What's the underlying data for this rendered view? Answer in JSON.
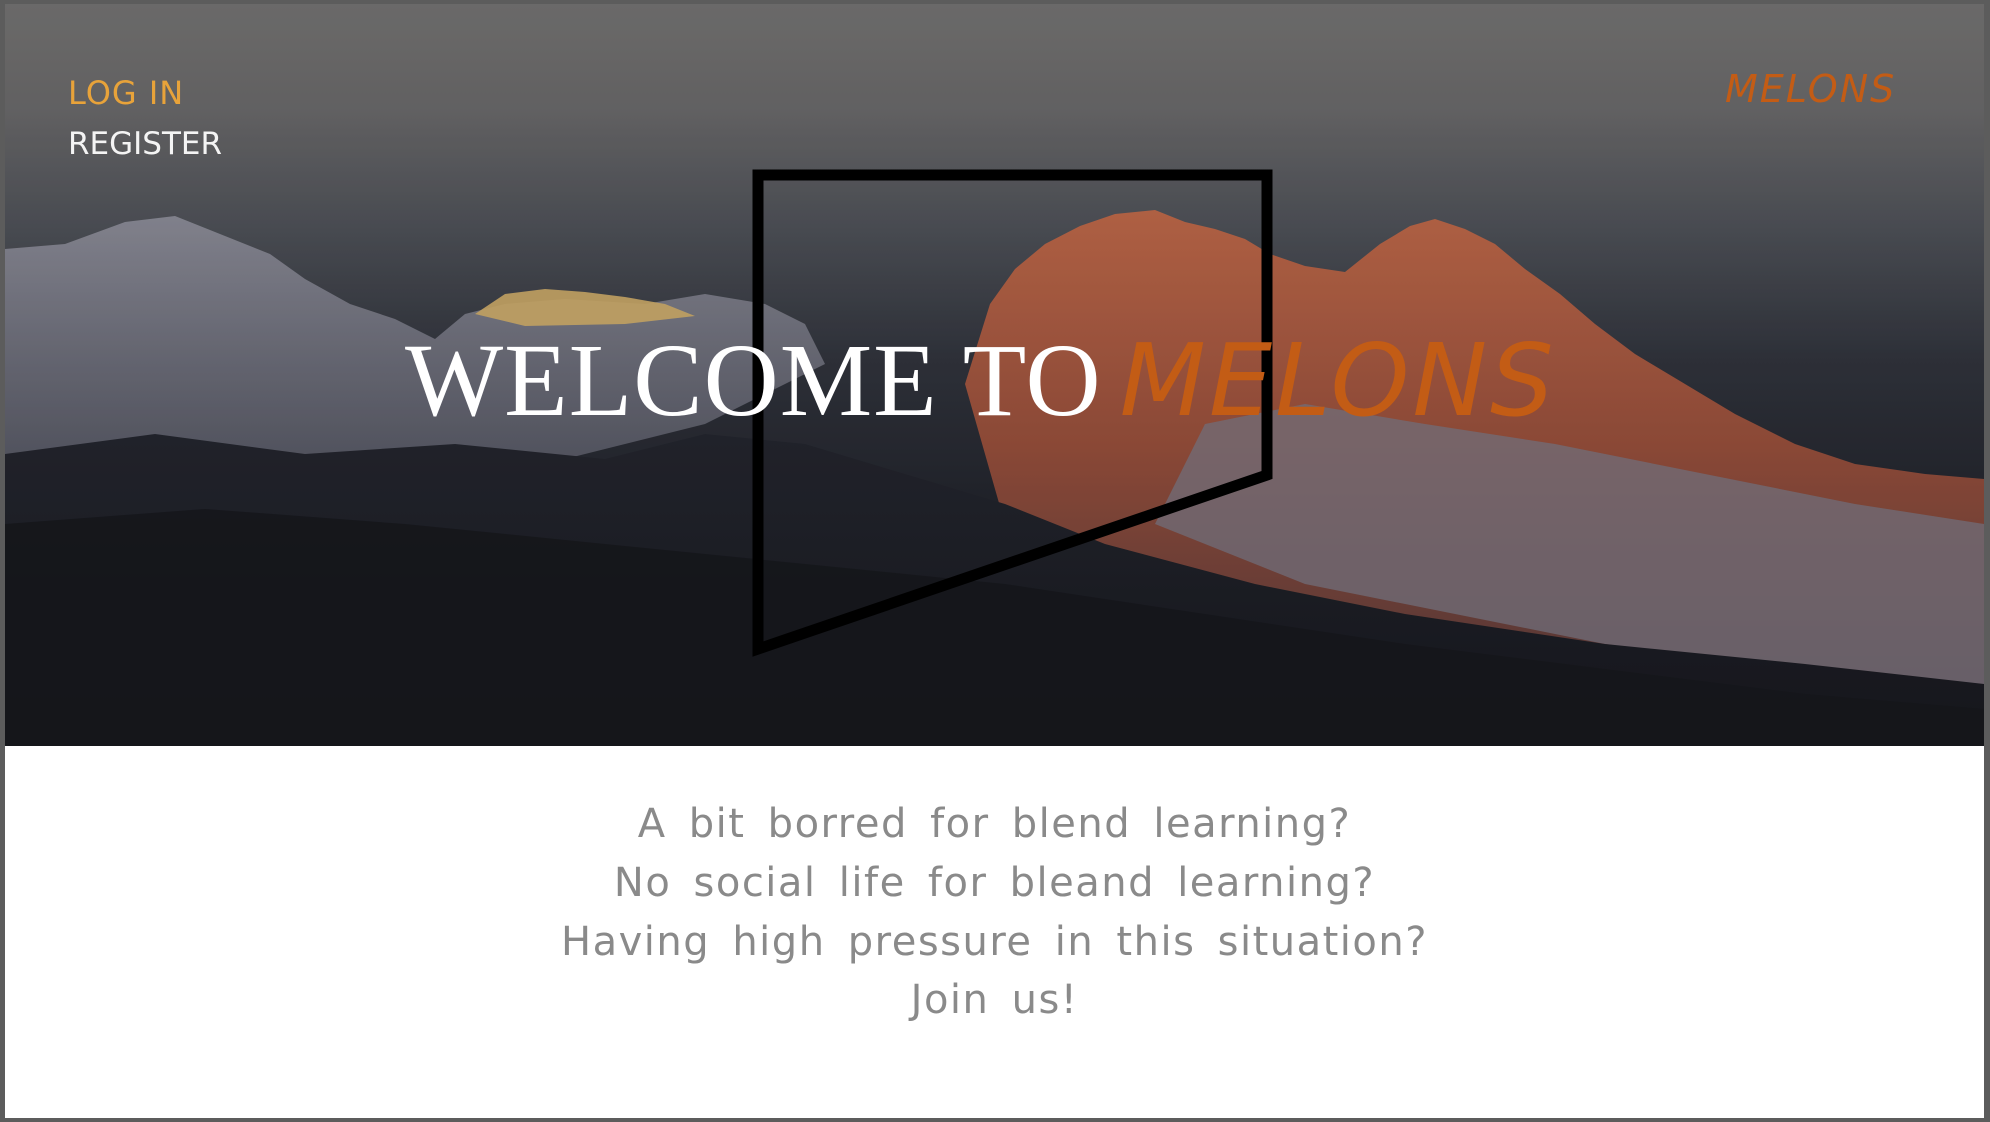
{
  "nav": {
    "login_label": "LOG IN",
    "register_label": "REGISTER"
  },
  "brand": {
    "name": "MELONS"
  },
  "hero": {
    "welcome_text": "WELCOME TO",
    "brand_text": "MELONS"
  },
  "content": {
    "lines": [
      "A bit borred for blend learning?",
      "No social life for bleand learning?",
      "Having high pressure in this situation?",
      "Join us!"
    ]
  },
  "colors": {
    "accent_orange": "#c35c15",
    "login_gold": "#e8a33a",
    "body_text_gray": "#8a8a8a",
    "hero_dark": "#1f2128"
  },
  "icons": {
    "logo_shape": "melons-logo-icon",
    "background": "mountain-landscape-image"
  }
}
